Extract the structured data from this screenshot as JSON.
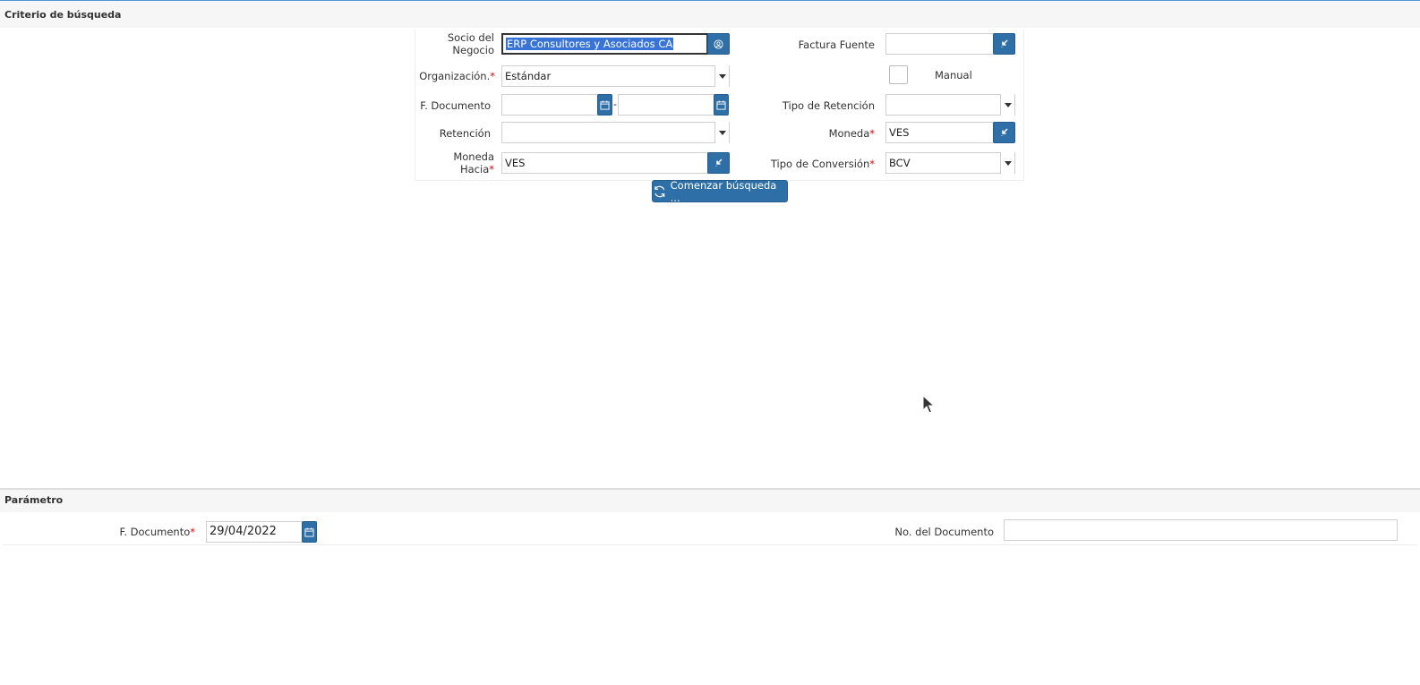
{
  "criteria": {
    "title": "Criterio de búsqueda",
    "socio_label_line1": "Socio del",
    "socio_label_line2": "Negocio",
    "socio_value": "ERP Consultores y Asociados CA",
    "organizacion_label": "Organización.",
    "organizacion_value": "Estándar",
    "f_documento_label": "F. Documento",
    "date_range_separator": "-",
    "retencion_label": "Retención",
    "moneda_hacia_label_line1": "Moneda",
    "moneda_hacia_label_line2": "Hacia",
    "moneda_hacia_value": "VES",
    "factura_fuente_label": "Factura Fuente",
    "manual_label": "Manual",
    "tipo_retencion_label": "Tipo de Retención",
    "moneda_label": "Moneda",
    "moneda_value": "VES",
    "tipo_conversion_label": "Tipo de Conversión",
    "tipo_conversion_value": "BCV",
    "search_button_label": "Comenzar búsqueda ...",
    "required_marker": "*"
  },
  "parametro": {
    "title": "Parámetro",
    "f_documento_label": "F. Documento",
    "f_documento_value": "29/04/2022",
    "no_documento_label": "No. del Documento"
  },
  "colors": {
    "accent_button": "#2e6fa7",
    "selection": "#3874d8",
    "required": "#d00000",
    "top_line": "#4a9ad6"
  }
}
